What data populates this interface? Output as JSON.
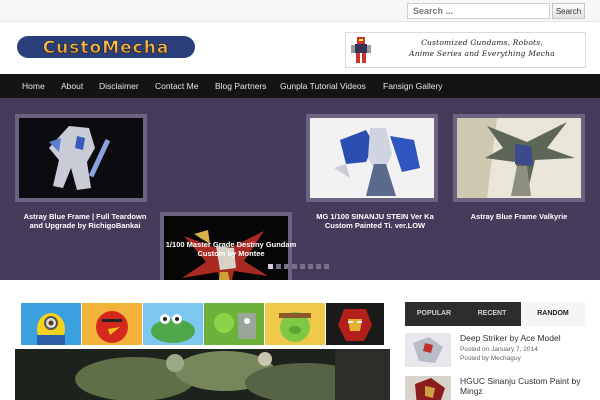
{
  "search": {
    "placeholder": "Search ...",
    "button_label": "Search"
  },
  "header": {
    "logo_text": "CustoMecha",
    "banner_line1": "Customized Gundams, Robots,",
    "banner_line2": "Anime Series and Everything Mecha"
  },
  "nav": {
    "items": [
      {
        "label": "Home"
      },
      {
        "label": "About"
      },
      {
        "label": "Disclaimer"
      },
      {
        "label": "Contact Me"
      },
      {
        "label": "Blog Partners"
      },
      {
        "label": "Gunpla Tutorial Videos"
      },
      {
        "label": "Fansign Gallery"
      }
    ]
  },
  "slider": {
    "slides": [
      {
        "caption": "Astray Blue Frame | Full Teardown and Upgrade by RichigoBankai"
      },
      {
        "caption": "1/100 Master Grade Destiny Gundam Custom by Montee"
      },
      {
        "caption": "MG 1/100 SINANJU STEIN Ver Ka Custom Painted Ti. ver.LOW"
      },
      {
        "caption": "Astray Blue Frame Valkyrie"
      }
    ]
  },
  "sidebar": {
    "tabs": [
      {
        "label": "POPULAR"
      },
      {
        "label": "RECENT"
      },
      {
        "label": "RANDOM"
      }
    ],
    "posts": [
      {
        "title": "Deep Striker by Ace Model",
        "date": "Posted on January 7, 2014",
        "author": "Posted by Mechaguy"
      },
      {
        "title": "HGUC Sinanju Custom Paint by Mingz",
        "date": "",
        "author": ""
      }
    ]
  },
  "colors": {
    "nav_bg": "#141414",
    "slider_bg": "#473b5c",
    "thumb_border": "#6c6380",
    "tabs_bg": "#2d2d2d"
  }
}
